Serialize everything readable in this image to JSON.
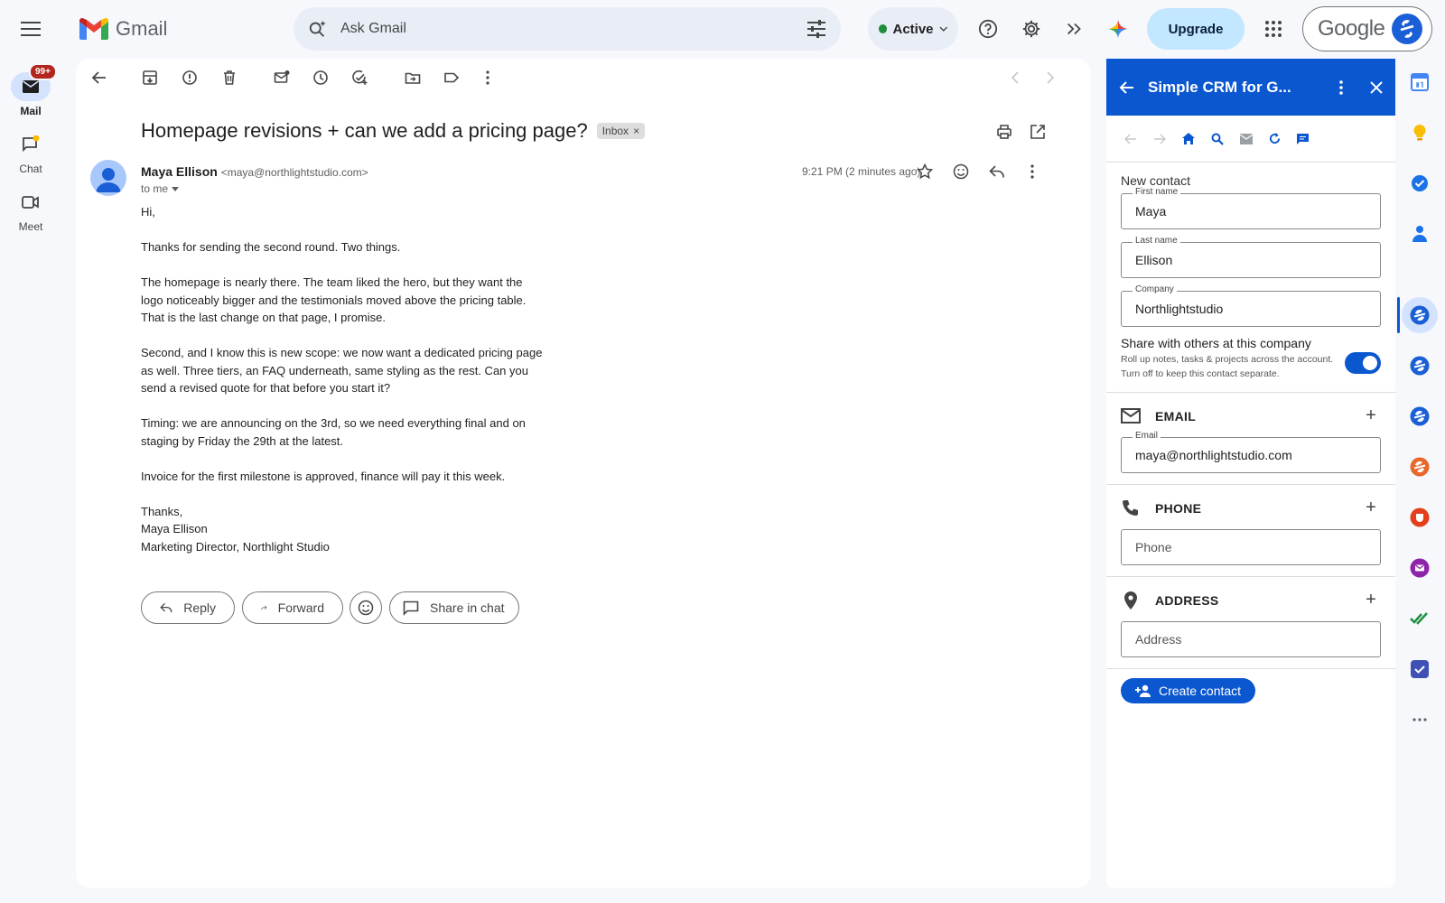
{
  "app": {
    "name": "Gmail",
    "search_placeholder": "Ask Gmail",
    "status": "Active",
    "upgrade_label": "Upgrade",
    "account_label": "Google"
  },
  "rail": {
    "mail_label": "Mail",
    "mail_badge": "99+",
    "chat_label": "Chat",
    "meet_label": "Meet"
  },
  "email": {
    "subject": "Homepage revisions + can we add a pricing page?",
    "label_chip": "Inbox",
    "sender_name": "Maya Ellison",
    "sender_email": "<maya@northlightstudio.com>",
    "to": "to me",
    "time": "9:21 PM (2 minutes ago)",
    "paragraphs": [
      "Hi,",
      "Thanks for sending the second round. Two things.",
      "The homepage is nearly there. The team liked the hero, but they want the\nlogo noticeably bigger and the testimonials moved above the pricing table.\nThat is the last change on that page, I promise.",
      "Second, and I know this is new scope: we now want a dedicated pricing page\nas well. Three tiers, an FAQ underneath, same styling as the rest. Can you\nsend a revised quote for that before you start it?",
      "Timing: we are announcing on the 3rd, so we need everything final and on\nstaging by Friday the 29th at the latest.",
      "Invoice for the first milestone is approved, finance will pay it this week.",
      "Thanks,\nMaya Ellison\nMarketing Director, Northlight Studio"
    ],
    "actions": {
      "reply": "Reply",
      "forward": "Forward",
      "share": "Share in chat"
    }
  },
  "crm": {
    "title": "Simple CRM for G...",
    "section_title": "New contact",
    "first_name_label": "First name",
    "first_name": "Maya",
    "last_name_label": "Last name",
    "last_name": "Ellison",
    "company_label": "Company",
    "company": "Northlightstudio",
    "share_title": "Share with others at this company",
    "share_desc": "Roll up notes, tasks & projects across the account. Turn off to keep this contact separate.",
    "share_enabled": true,
    "email_section": "EMAIL",
    "email_label": "Email",
    "email_value": "maya@northlightstudio.com",
    "phone_section": "PHONE",
    "phone_placeholder": "Phone",
    "address_section": "ADDRESS",
    "address_placeholder": "Address",
    "create_label": "Create contact"
  },
  "colors": {
    "accent": "#0b57d0",
    "status_green": "#1e8e3e",
    "badge_red": "#b3261e"
  }
}
